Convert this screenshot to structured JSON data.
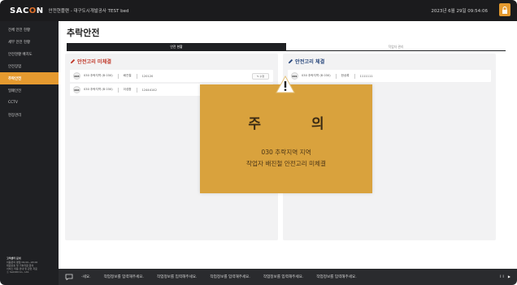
{
  "header": {
    "logo_prefix": "SAC",
    "logo_o": "O",
    "logo_suffix": "N",
    "site_title": "안전현플랜 - 대구도시개발공사 TEST bed",
    "datetime": "2023년 6월 29일 09:54:06",
    "lock_icon": "lock-icon"
  },
  "sidebar": {
    "items": [
      {
        "label": "전체 안전 현황",
        "active": false
      },
      {
        "label": "세부 안전 현황",
        "active": false
      },
      {
        "label": "안전현황 배치도",
        "active": false
      },
      {
        "label": "안전장업",
        "active": false
      },
      {
        "label": "추락안전",
        "active": true
      },
      {
        "label": "밀폐안전",
        "active": false
      },
      {
        "label": "CCTV",
        "active": false
      },
      {
        "label": "현장관리",
        "active": false
      }
    ],
    "footer_title": "고객센터 문의",
    "footer_lines": [
      "이용문의 평일 09:00~18:00",
      "대표번호 및 기술지원 문의",
      "서비스 이용 안내 및 관련 자료",
      "ⓒ SACON Co., Ltd."
    ]
  },
  "main": {
    "title": "추락안전",
    "tabs": [
      {
        "label": "안전 현황",
        "active": true
      },
      {
        "label": "작업자 관리",
        "active": false
      }
    ],
    "left_panel": {
      "title": "안전고리 미체결",
      "rows": [
        {
          "badge": "003",
          "zone": "030 추락지역 (B 030)",
          "name": "배진철",
          "id": "120120",
          "action": "수정"
        },
        {
          "badge": "004",
          "zone": "030 추락지역 (B 030)",
          "name": "이성환",
          "id": "12444142",
          "action": ""
        }
      ]
    },
    "right_panel": {
      "title": "안전고리 체결",
      "rows": [
        {
          "badge": "001",
          "zone": "030 추락지역 (B 030)",
          "name": "한상록",
          "id": "1111111"
        }
      ]
    }
  },
  "warning": {
    "icon": "warning-icon",
    "title": "주 의",
    "line1": "030 추락지역 지역",
    "line2": "작업자 배진철 안전고리 미체결",
    "color": "#d9a23d"
  },
  "ticker": {
    "items": [
      "-세요.",
      "작업정보를 입력해주세요.",
      "작업정보를 입력해주세요.",
      "작업정보를 입력해주세요.",
      "작업정보를 입력해주세요.",
      "작업정보를 입력해주세요."
    ],
    "controls": "II ▶"
  }
}
